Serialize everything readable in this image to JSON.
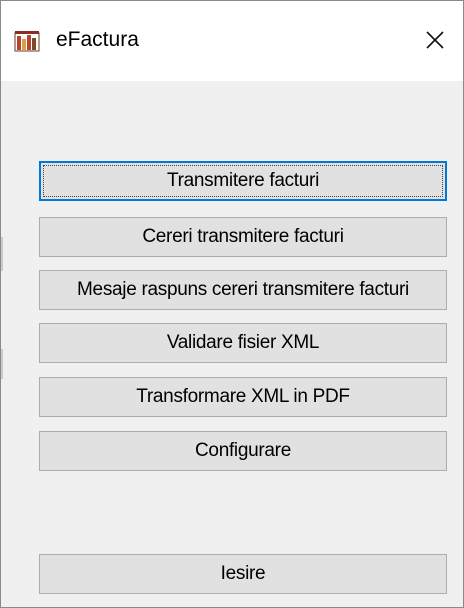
{
  "window": {
    "title": "eFactura",
    "icon": "efactura-app-icon",
    "close_icon": "close-icon"
  },
  "buttons": {
    "transmitere": "Transmitere facturi",
    "cereri": "Cereri transmitere facturi",
    "mesaje": "Mesaje raspuns cereri transmitere facturi",
    "validare": "Validare fisier XML",
    "transformare": "Transformare XML in PDF",
    "configurare": "Configurare",
    "iesire": "Iesire"
  },
  "colors": {
    "focus_border": "#0078d7",
    "button_face": "#e1e1e1",
    "window_background": "#f0f0f0"
  }
}
